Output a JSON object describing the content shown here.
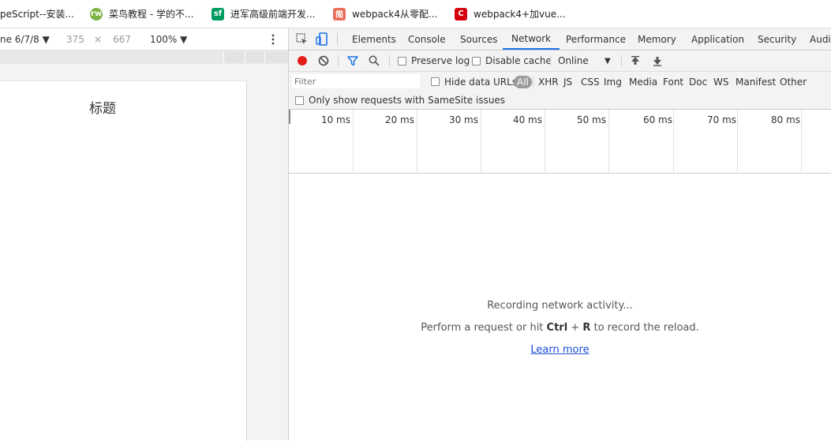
{
  "bookmarks": [
    {
      "label": "peScript--安装...",
      "color": "#3c8dde",
      "glyph": ""
    },
    {
      "label": "菜鸟教程 - 学的不...",
      "color": "#7cb342",
      "glyph": "rw"
    },
    {
      "label": "进军高级前端开发...",
      "color": "#009a61",
      "glyph": "sf"
    },
    {
      "label": "webpack4从零配...",
      "color": "#ea6f5a",
      "glyph": "简"
    },
    {
      "label": "webpack4+加vue...",
      "color": "#d7000f",
      "glyph": "C"
    }
  ],
  "device_toolbar": {
    "device": "ne 6/7/8 ▼",
    "width": "375",
    "times": "×",
    "height": "667",
    "zoom": "100% ▼"
  },
  "page": {
    "heading": "标题"
  },
  "devtools": {
    "tabs": [
      "Elements",
      "Console",
      "Sources",
      "Network",
      "Performance",
      "Memory",
      "Application",
      "Security",
      "Audit"
    ],
    "active_tab": "Network"
  },
  "network_toolbar": {
    "preserve_log": "Preserve log",
    "disable_cache": "Disable cache",
    "throttle": "Online",
    "throttle_arrow": "▼"
  },
  "filter_bar": {
    "placeholder": "Filter",
    "hide_data_urls": "Hide data URLs",
    "types": [
      "All",
      "XHR",
      "JS",
      "CSS",
      "Img",
      "Media",
      "Font",
      "Doc",
      "WS",
      "Manifest",
      "Other"
    ]
  },
  "samesite": {
    "label": "Only show requests with SameSite issues"
  },
  "timeline": {
    "ticks": [
      "10 ms",
      "20 ms",
      "30 ms",
      "40 ms",
      "50 ms",
      "60 ms",
      "70 ms",
      "80 ms"
    ]
  },
  "empty_state": {
    "line1": "Recording network activity...",
    "line2_pre": "Perform a request or hit ",
    "key_ctrl": "Ctrl",
    "plus": " + ",
    "key_r": "R",
    "line2_post": " to record the reload.",
    "learn_more": "Learn more"
  },
  "colors": {
    "record": "#e41b17",
    "accent": "#1a73e8",
    "link": "#1a4ed8"
  }
}
